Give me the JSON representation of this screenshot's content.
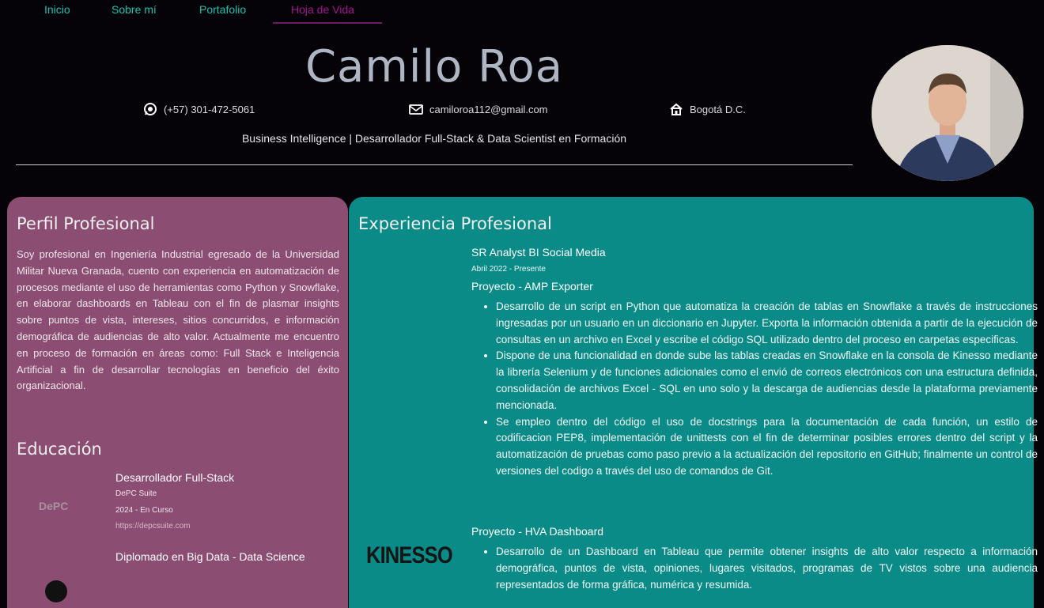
{
  "nav": {
    "items": [
      {
        "label": "Inicio",
        "active": false
      },
      {
        "label": "Sobre mí",
        "active": false
      },
      {
        "label": "Portafolio",
        "active": false
      },
      {
        "label": "Hoja de Vida",
        "active": true
      }
    ]
  },
  "header": {
    "name": "Camilo Roa",
    "phone": "(+57) 301-472-5061",
    "email": "camiloroa112@gmail.com",
    "location": "Bogotá D.C.",
    "subtitle": "Business Intelligence | Desarrollador Full-Stack & Data Scientist en Formación"
  },
  "profile": {
    "heading": "Perfil Profesional",
    "text": "Soy profesional en Ingeniería Industrial egresado de la Universidad Militar Nueva Granada, cuento con experiencia en automatización de procesos mediante el uso de herramientas como Python y Snowflake, en elaborar dashboards en Tableau con el fin de plasmar insights sobre puntos de vista, intereses, sitios concurridos, e información demográfica de audiencias de alto valor. Actualmente me encuentro en proceso de formación en áreas como: Full Stack e Inteligencia Artificial a fin de desarrollar tecnologías en beneficio del éxito organizacional."
  },
  "education": {
    "heading": "Educación",
    "items": [
      {
        "logo_text": "DePC",
        "title": "Desarrollador Full-Stack",
        "institution": "DePC Suite",
        "date": "2024 - En Curso",
        "link": "https://depcsuite.com"
      },
      {
        "title": "Diplomado en Big Data - Data Science"
      }
    ]
  },
  "experience": {
    "heading": "Experiencia Profesional",
    "company_logo": "KINESSO",
    "job_title": "SR Analyst BI Social Media",
    "job_date": "Abril 2022 - Presente",
    "projects": [
      {
        "title": "Proyecto - AMP Exporter",
        "bullets": [
          "Desarrollo de un script en Python que automatiza la creación de tablas en Snowflake a través de instrucciones ingresadas por un usuario en un diccionario en Jupyter. Exporta la información obtenida a partir de la ejecución de consultas en un archivo en Excel y escribe el código SQL utilizado dentro del proceso en carpetas especificas.",
          "Dispone de una funcionalidad en donde sube las tablas creadas en Snowflake en la consola de Kinesso mediante la librería Selenium y de funciones adicionales como el envió de correos electrónicos con una estructura definida, consolidación de archivos Excel - SQL en uno solo y la descarga de audiencias desde la plataforma previamente mencionada.",
          "Se empleo dentro del código el uso de docstrings para la documentación de cada función, un estilo de codificacion PEP8, implementación de unittests con el fin de determinar posibles errores dentro del script y la automatización de pruebas como paso previo a la actualización del repositorio en GitHub; finalmente un control de versiones del codigo a través del uso de comandos de Git."
        ]
      },
      {
        "title": "Proyecto - HVA Dashboard",
        "bullets": [
          "Desarrollo de un Dashboard en Tableau que permite obtener insights de alto valor respecto a información demográfica, puntos de vista, opiniones, lugares visitados, programas de TV vistos sobre una audiencia representados de forma gráfica, numérica y resumida."
        ]
      }
    ]
  },
  "colors": {
    "background": "#050307",
    "nav_link": "#19c3b3",
    "nav_active": "#a5148f",
    "profile_panel": "#8b4d71",
    "experience_panel": "#0a8b87"
  }
}
